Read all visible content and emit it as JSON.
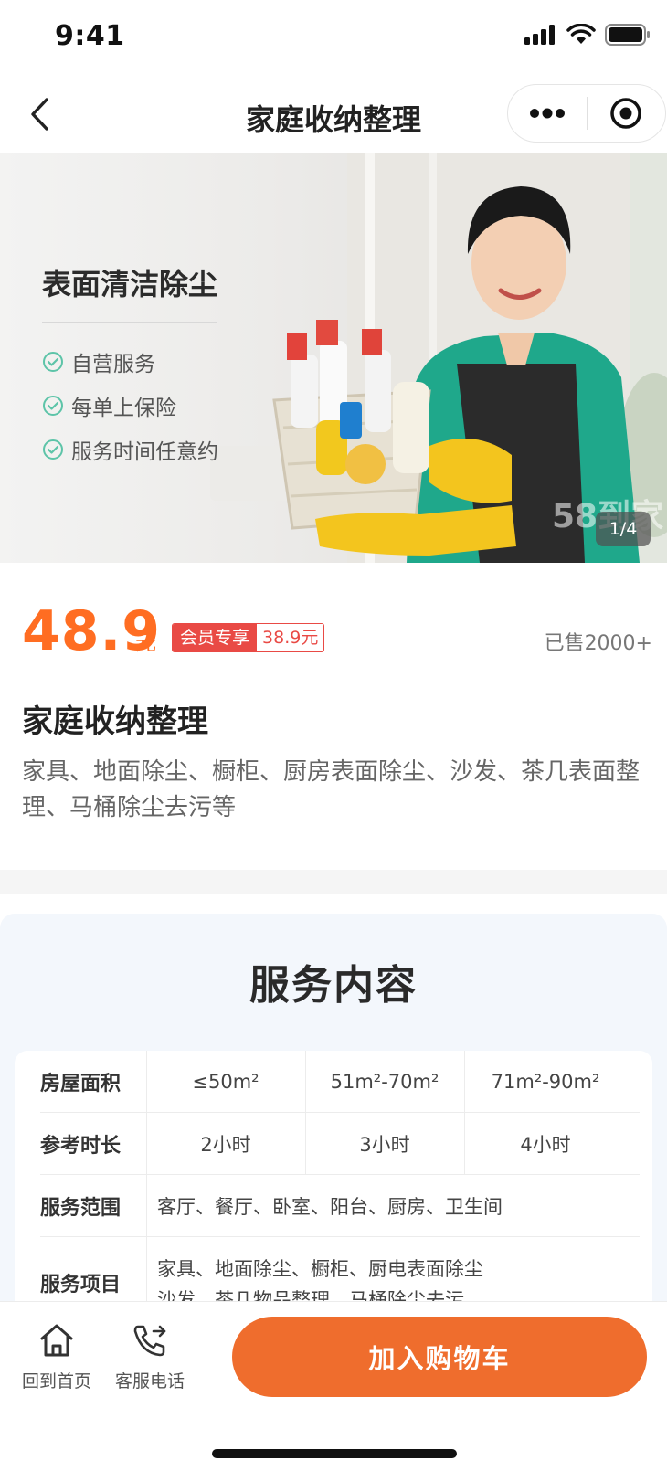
{
  "status_bar": {
    "time": "9:41"
  },
  "nav": {
    "title": "家庭收纳整理"
  },
  "banner": {
    "title": "表面清洁除尘",
    "features": [
      "自营服务",
      "每单上保险",
      "服务时间任意约"
    ],
    "counter": "1/4",
    "watermark": "58到家",
    "check_color": "#5dc4a8"
  },
  "product": {
    "price": "48.9",
    "price_unit": "元",
    "member_tag": "会员专享",
    "member_price": "38.9元",
    "sold": "已售2000+",
    "title": "家庭收纳整理",
    "description": "家具、地面除尘、橱柜、厨房表面除尘、沙发、茶几表面整理、马桶除尘去污等",
    "accent_color": "#ff6d22"
  },
  "service": {
    "heading": "服务内容",
    "rows": {
      "area": {
        "label": "房屋面积",
        "values": [
          "≤50m²",
          "51m²-70m²",
          "71m²-90m²"
        ]
      },
      "duration": {
        "label": "参考时长",
        "values": [
          "2小时",
          "3小时",
          "4小时"
        ]
      },
      "scope": {
        "label": "服务范围",
        "value": "客厅、餐厅、卧室、阳台、厨房、卫生间"
      },
      "items": {
        "label": "服务项目",
        "line1": "家具、地面除尘、橱柜、厨电表面除尘",
        "line2": "沙发、茶几物品整理、马桶除尘去污"
      }
    }
  },
  "bottom_bar": {
    "home_label": "回到首页",
    "phone_label": "客服电话",
    "cart_label": "加入购物车",
    "cart_color": "#ef6d2d",
    "home_icon": "home-icon",
    "phone_icon": "phone-icon"
  }
}
